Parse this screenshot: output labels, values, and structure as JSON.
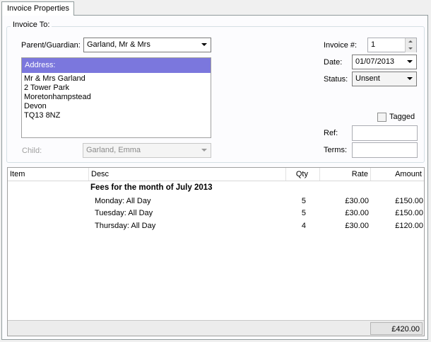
{
  "tab": {
    "label": "Invoice Properties"
  },
  "invoice_to": {
    "legend": "Invoice To:",
    "parent_label": "Parent/Guardian:",
    "parent_value": "Garland, Mr & Mrs",
    "address_header": "Address:",
    "address_lines": [
      "Mr & Mrs Garland",
      "2 Tower Park",
      "Moretonhampstead",
      "Devon",
      "TQ13 8NZ"
    ],
    "child_label": "Child:",
    "child_value": "Garland, Emma"
  },
  "details": {
    "invoice_no_label": "Invoice #:",
    "invoice_no_value": "1",
    "date_label": "Date:",
    "date_value": "01/07/2013",
    "status_label": "Status:",
    "status_value": "Unsent",
    "tagged_label": "Tagged",
    "tagged_checked": false,
    "ref_label": "Ref:",
    "ref_value": "",
    "terms_label": "Terms:",
    "terms_value": ""
  },
  "grid": {
    "columns": {
      "item": "Item",
      "desc": "Desc",
      "qty": "Qty",
      "rate": "Rate",
      "amount": "Amount"
    },
    "group_title": "Fees for the month of July 2013",
    "rows": [
      {
        "desc": "Monday: All Day",
        "qty": "5",
        "rate": "£30.00",
        "amount": "£150.00"
      },
      {
        "desc": "Tuesday: All Day",
        "qty": "5",
        "rate": "£30.00",
        "amount": "£150.00"
      },
      {
        "desc": "Thursday: All Day",
        "qty": "4",
        "rate": "£30.00",
        "amount": "£120.00"
      }
    ],
    "total": "£420.00"
  }
}
